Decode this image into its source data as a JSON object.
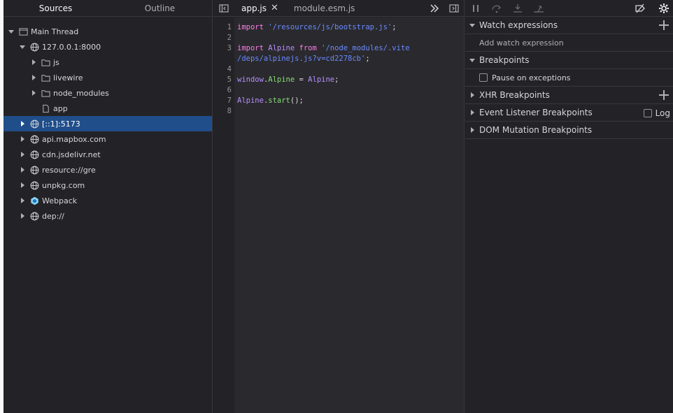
{
  "sources_panel": {
    "tabs": [
      {
        "label": "Sources",
        "active": true
      },
      {
        "label": "Outline",
        "active": false
      }
    ],
    "tree": [
      {
        "label": "Main Thread",
        "icon": "window-icon",
        "depth": 0,
        "arrow": "down"
      },
      {
        "label": "127.0.0.1:8000",
        "icon": "globe-icon",
        "depth": 1,
        "arrow": "down"
      },
      {
        "label": "js",
        "icon": "folder-icon",
        "depth": 2,
        "arrow": "right"
      },
      {
        "label": "livewire",
        "icon": "folder-icon",
        "depth": 2,
        "arrow": "right"
      },
      {
        "label": "node_modules",
        "icon": "folder-icon",
        "depth": 2,
        "arrow": "right"
      },
      {
        "label": "app",
        "icon": "file-icon",
        "depth": 2,
        "arrow": "none"
      },
      {
        "label": "[::1]:5173",
        "icon": "globe-icon",
        "depth": 1,
        "arrow": "right",
        "selected": true
      },
      {
        "label": "api.mapbox.com",
        "icon": "globe-icon",
        "depth": 1,
        "arrow": "right"
      },
      {
        "label": "cdn.jsdelivr.net",
        "icon": "globe-icon",
        "depth": 1,
        "arrow": "right"
      },
      {
        "label": "resource://gre",
        "icon": "globe-icon",
        "depth": 1,
        "arrow": "right"
      },
      {
        "label": "unpkg.com",
        "icon": "globe-icon",
        "depth": 1,
        "arrow": "right"
      },
      {
        "label": "Webpack",
        "icon": "webpack-icon",
        "depth": 1,
        "arrow": "right"
      },
      {
        "label": "dep://",
        "icon": "globe-icon",
        "depth": 1,
        "arrow": "right"
      }
    ]
  },
  "editor": {
    "tabs": [
      {
        "label": "app.js",
        "active": true,
        "closable": true
      },
      {
        "label": "module.esm.js",
        "active": false,
        "closable": false
      }
    ],
    "lines": [
      {
        "num": "1",
        "tokens": [
          {
            "t": "import",
            "c": "kw"
          },
          {
            "t": " "
          },
          {
            "t": "'/resources/js/bootstrap.js'",
            "c": "str"
          },
          {
            "t": ";"
          }
        ]
      },
      {
        "num": "2",
        "tokens": []
      },
      {
        "num": "3",
        "tokens": [
          {
            "t": "import",
            "c": "kw"
          },
          {
            "t": " "
          },
          {
            "t": "Alpine",
            "c": "var"
          },
          {
            "t": " "
          },
          {
            "t": "from",
            "c": "kw"
          },
          {
            "t": " "
          },
          {
            "t": "'/node_modules/.vite",
            "c": "str"
          }
        ]
      },
      {
        "num": "",
        "tokens": [
          {
            "t": "/deps/alpinejs.js?v=cd2278cb'",
            "c": "str"
          },
          {
            "t": ";"
          }
        ]
      },
      {
        "num": "4",
        "tokens": []
      },
      {
        "num": "5",
        "tokens": [
          {
            "t": "window",
            "c": "var"
          },
          {
            "t": "."
          },
          {
            "t": "Alpine",
            "c": "prop"
          },
          {
            "t": " = "
          },
          {
            "t": "Alpine",
            "c": "var"
          },
          {
            "t": ";"
          }
        ]
      },
      {
        "num": "6",
        "tokens": []
      },
      {
        "num": "7",
        "tokens": [
          {
            "t": "Alpine",
            "c": "var"
          },
          {
            "t": "."
          },
          {
            "t": "start",
            "c": "prop"
          },
          {
            "t": "();"
          }
        ]
      },
      {
        "num": "8",
        "tokens": []
      }
    ]
  },
  "debugger": {
    "watch": {
      "title": "Watch expressions",
      "placeholder": "Add watch expression"
    },
    "breakpoints": {
      "title": "Breakpoints",
      "pause_label": "Pause on exceptions"
    },
    "xhr": {
      "title": "XHR Breakpoints"
    },
    "event_listener": {
      "title": "Event Listener Breakpoints",
      "log_label": "Log"
    },
    "dom_mutation": {
      "title": "DOM Mutation Breakpoints"
    }
  }
}
